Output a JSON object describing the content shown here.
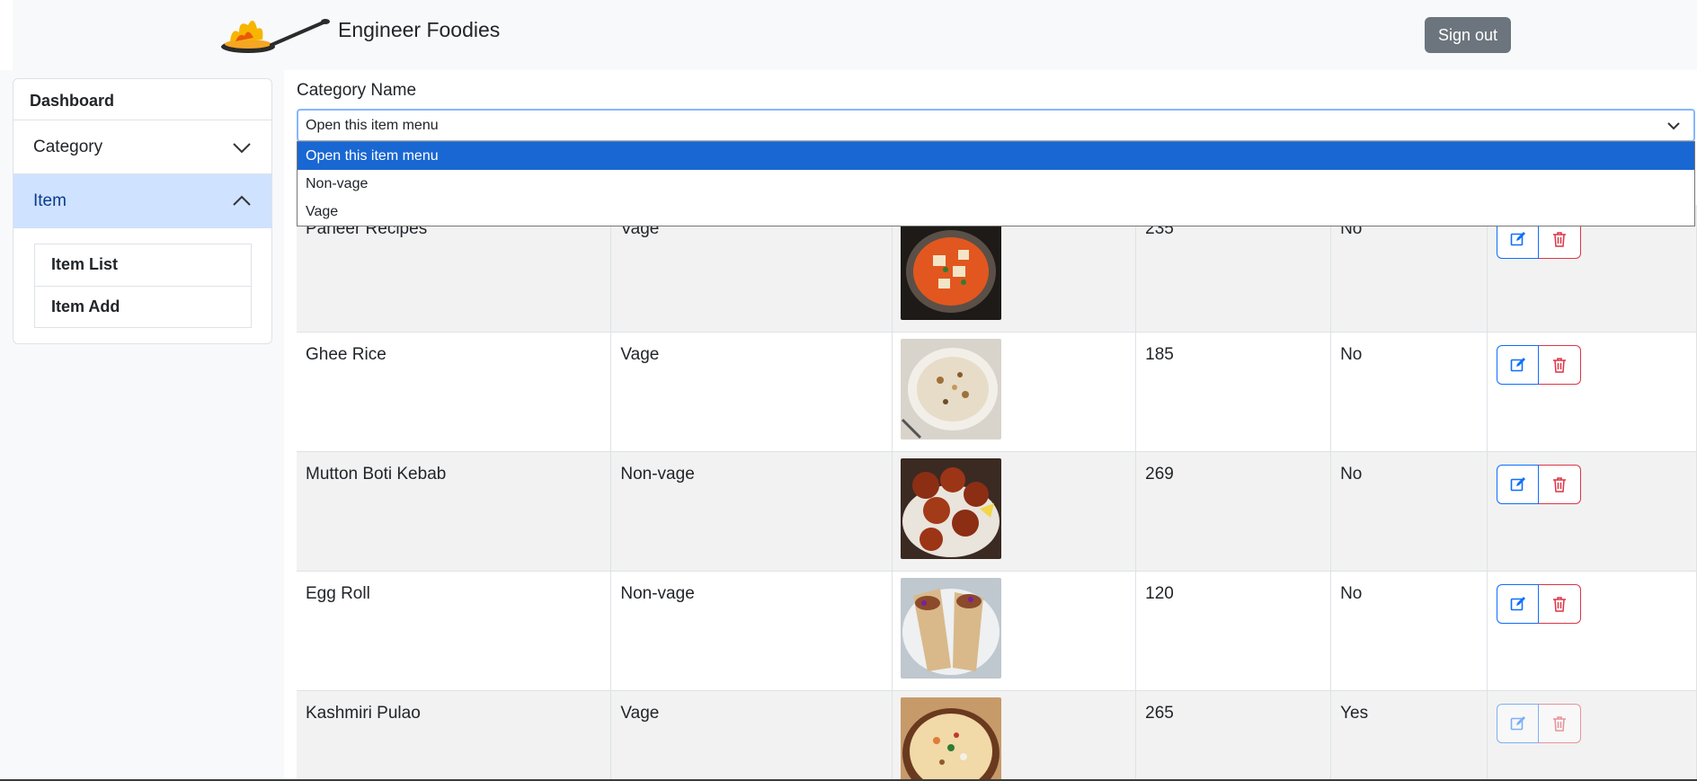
{
  "header": {
    "brand": "Engineer Foodies",
    "signout_label": "Sign out"
  },
  "sidebar": {
    "dashboard": "Dashboard",
    "category": "Category",
    "item": "Item",
    "item_list": "Item List",
    "item_add": "Item Add"
  },
  "form": {
    "category_label": "Category Name",
    "selected": "Open this item menu",
    "options": [
      "Open this item menu",
      "Non-vage",
      "Vage"
    ]
  },
  "items": [
    {
      "name": "Paneer Recipes",
      "category": "Vage",
      "price": "235",
      "status": "No",
      "image": "paneer-curry"
    },
    {
      "name": "Ghee Rice",
      "category": "Vage",
      "price": "185",
      "status": "No",
      "image": "ghee-rice"
    },
    {
      "name": "Mutton Boti Kebab",
      "category": "Non-vage",
      "price": "269",
      "status": "No",
      "image": "kebab"
    },
    {
      "name": "Egg Roll",
      "category": "Non-vage",
      "price": "120",
      "status": "No",
      "image": "egg-roll"
    },
    {
      "name": "Kashmiri Pulao",
      "category": "Vage",
      "price": "265",
      "status": "Yes",
      "image": "pulao"
    }
  ],
  "colors": {
    "primary": "#0d6efd",
    "danger": "#dc3545",
    "secondary": "#6c757d",
    "active_bg": "#cfe2ff",
    "dropdown_highlight": "#1967d2"
  }
}
